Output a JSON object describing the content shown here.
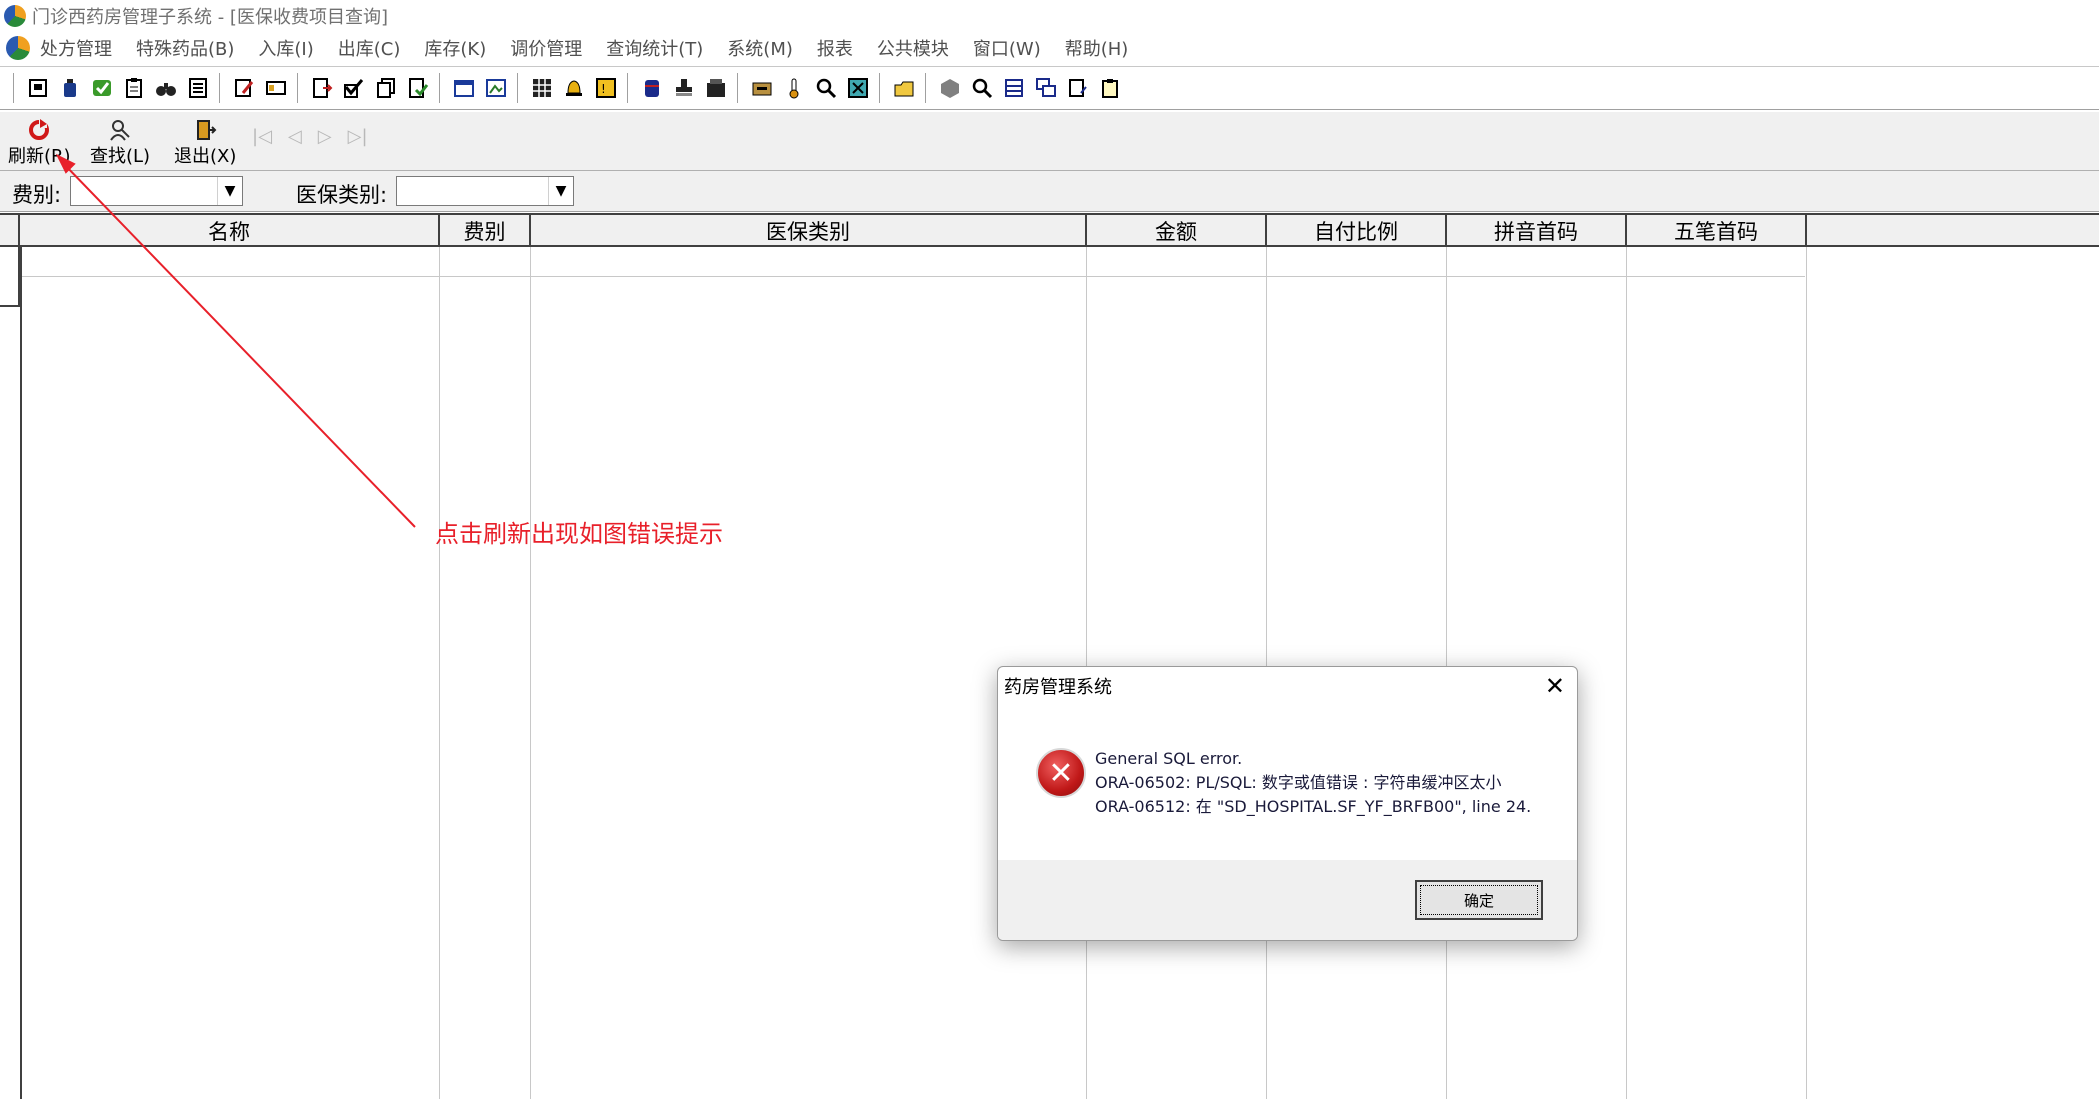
{
  "window": {
    "title": "门诊西药房管理子系统 - [医保收费项目查询]"
  },
  "menu": [
    {
      "label": "处方管理"
    },
    {
      "label": "特殊药品(B)"
    },
    {
      "label": "入库(I)"
    },
    {
      "label": "出库(C)"
    },
    {
      "label": "库存(K)"
    },
    {
      "label": "调价管理"
    },
    {
      "label": "查询统计(T)"
    },
    {
      "label": "系统(M)"
    },
    {
      "label": "报表"
    },
    {
      "label": "公共模块"
    },
    {
      "label": "窗口(W)"
    },
    {
      "label": "帮助(H)"
    }
  ],
  "toolbar_icons": [
    "printer-icon",
    "bottle-icon",
    "check-box-icon",
    "clipboard-icon",
    "binoculars-icon",
    "document-list-icon",
    "edit-doc-icon",
    "card-icon",
    "page-export-icon",
    "checklist-icon",
    "copy-icon",
    "page-check-icon",
    "form-icon",
    "image-box-icon",
    "grid-icon",
    "bell-icon",
    "warning-box-icon",
    "barrel-icon",
    "stamp-icon",
    "crate-icon",
    "cabinet-icon",
    "thermometer-icon",
    "magnifier-icon",
    "cancel-box-icon",
    "folder-icon",
    "cube-icon",
    "zoom-icon",
    "table-icon",
    "windows-icon",
    "notes-icon",
    "clipboard-check-icon"
  ],
  "actions": {
    "refresh": "刷新(R)",
    "find": "查找(L)",
    "exit": "退出(X)"
  },
  "filters": {
    "fee_type_label": "费别:",
    "fee_type_value": "",
    "insurance_type_label": "医保类别:",
    "insurance_type_value": ""
  },
  "grid": {
    "columns": [
      "名称",
      "费别",
      "医保类别",
      "金额",
      "自付比例",
      "拼音首码",
      "五笔首码"
    ],
    "rows": []
  },
  "annotation": {
    "text": "点击刷新出现如图错误提示",
    "color": "#e8202a"
  },
  "dialog": {
    "title": "药房管理系统",
    "close": "✕",
    "icon": "error-icon",
    "lines": [
      "General SQL error.",
      "ORA-06502: PL/SQL: 数字或值错误 :  字符串缓冲区太小",
      "ORA-06512: 在 \"SD_HOSPITAL.SF_YF_BRFB00\", line 24."
    ],
    "ok_label": "确定"
  }
}
